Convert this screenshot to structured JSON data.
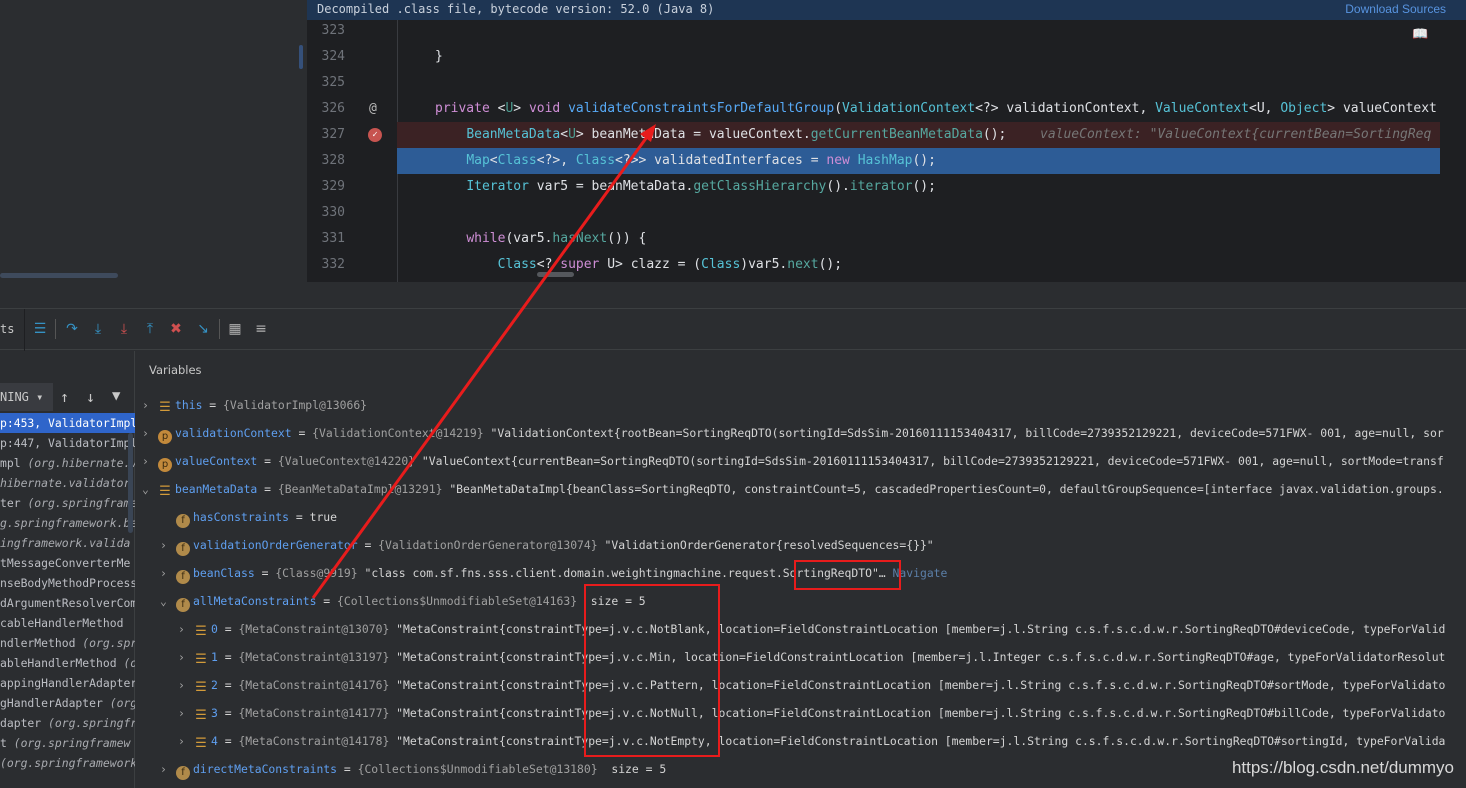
{
  "editor": {
    "banner": "Decompiled .class file, bytecode version: 52.0 (Java 8)",
    "download_sources": "Download Sources",
    "lines": [
      {
        "n": "323"
      },
      {
        "n": "324",
        "text": "}"
      },
      {
        "n": "325"
      },
      {
        "n": "326",
        "icon": "override-at-icon",
        "text": "private <U> void validateConstraintsForDefaultGroup(ValidationContext<?> validationContext, ValueContext<U, Object> valueContext"
      },
      {
        "n": "327",
        "icon": "breakpoint-icon",
        "text": "    BeanMetaData<U> beanMetaData = valueContext.getCurrentBeanMetaData();",
        "hint": "valueContext: \"ValueContext{currentBean=SortingReq"
      },
      {
        "n": "328",
        "text": "    Map<Class<?>, Class<?>> validatedInterfaces = new HashMap();"
      },
      {
        "n": "329",
        "text": "    Iterator var5 = beanMetaData.getClassHierarchy().iterator();"
      },
      {
        "n": "330"
      },
      {
        "n": "331",
        "text": "    while(var5.hasNext()) {"
      },
      {
        "n": "332",
        "text": "        Class<? super U> clazz = (Class)var5.next();"
      }
    ]
  },
  "toolbar": {
    "tab_partial": "ts",
    "buttons": [
      "show-execution-point",
      "step-over",
      "step-into",
      "force-step-into",
      "step-out",
      "drop-frame",
      "run-to-cursor",
      "evaluate-expression",
      "trace-current-stream"
    ]
  },
  "frames": {
    "thread_select": "NING",
    "items": [
      [
        "p:453, ValidatorImpl",
        ""
      ],
      [
        "p:447, ValidatorImpl",
        ""
      ],
      [
        "mpl ",
        "(org.hibernate.v"
      ],
      [
        "",
        "hibernate.validator"
      ],
      [
        "ter ",
        "(org.springframe"
      ],
      [
        "",
        "g.springframework.be"
      ],
      [
        "",
        "ingframework.valida"
      ],
      [
        "tMessageConverterMe",
        ""
      ],
      [
        "nseBodyMethodProcess",
        ""
      ],
      [
        "dArgumentResolverCom",
        ""
      ],
      [
        "cableHandlerMethod ",
        ""
      ],
      [
        "ndlerMethod ",
        "(org.spr"
      ],
      [
        "ableHandlerMethod ",
        "(o"
      ],
      [
        "appingHandlerAdapter",
        ""
      ],
      [
        "gHandlerAdapter ",
        "(org"
      ],
      [
        "dapter ",
        "(org.springfr"
      ],
      [
        "t ",
        "(org.springframew"
      ],
      [
        "",
        "(org.springframework"
      ]
    ]
  },
  "variables": {
    "header": "Variables",
    "rows": [
      {
        "chev": ">",
        "icon": "list",
        "name": "this",
        "type": "{ValidatorImpl@13066}",
        "value": ""
      },
      {
        "chev": ">",
        "icon": "p",
        "name": "validationContext",
        "type": "{ValidationContext@14219}",
        "value": "\"ValidationContext{rootBean=SortingReqDTO(sortingId=SdsSim-20160111153404317, billCode=2739352129221, deviceCode=571FWX- 001, age=null, sor"
      },
      {
        "chev": ">",
        "icon": "p",
        "name": "valueContext",
        "type": "{ValueContext@14220}",
        "value": "\"ValueContext{currentBean=SortingReqDTO(sortingId=SdsSim-20160111153404317, billCode=2739352129221, deviceCode=571FWX- 001, age=null, sortMode=transf"
      },
      {
        "chev": "v",
        "icon": "list",
        "name": "beanMetaData",
        "type": "{BeanMetaDataImpl@13291}",
        "value": "\"BeanMetaDataImpl{beanClass=SortingReqDTO, constraintCount=5, cascadedPropertiesCount=0, defaultGroupSequence=[interface javax.validation.groups."
      },
      {
        "chev": "",
        "icon": "f",
        "name": "hasConstraints",
        "type": "",
        "value": "true"
      },
      {
        "chev": ">",
        "icon": "f",
        "name": "validationOrderGenerator",
        "type": "{ValidationOrderGenerator@13074}",
        "value": "\"ValidationOrderGenerator{resolvedSequences={}}\""
      },
      {
        "chev": ">",
        "icon": "f",
        "name": "beanClass",
        "type": "{Class@9919}",
        "value": "\"class com.sf.fns.sss.client.domain.weightingmachine.request.SortingReqDTO\"…",
        "nav": "Navigate"
      },
      {
        "chev": "v",
        "icon": "f",
        "name": "allMetaConstraints",
        "type": "{Collections$UnmodifiableSet@14163}",
        "value": " size = 5"
      },
      {
        "chev": ">",
        "icon": "list",
        "name": "0",
        "type": "{MetaConstraint@13070}",
        "value": "\"MetaConstraint{constraintType=j.v.c.NotBlank, location=FieldConstraintLocation [member=j.l.String c.s.f.s.c.d.w.r.SortingReqDTO#deviceCode, typeForValid"
      },
      {
        "chev": ">",
        "icon": "list",
        "name": "1",
        "type": "{MetaConstraint@13197}",
        "value": "\"MetaConstraint{constraintType=j.v.c.Min, location=FieldConstraintLocation [member=j.l.Integer c.s.f.s.c.d.w.r.SortingReqDTO#age, typeForValidatorResolut"
      },
      {
        "chev": ">",
        "icon": "list",
        "name": "2",
        "type": "{MetaConstraint@14176}",
        "value": "\"MetaConstraint{constraintType=j.v.c.Pattern, location=FieldConstraintLocation [member=j.l.String c.s.f.s.c.d.w.r.SortingReqDTO#sortMode, typeForValidato"
      },
      {
        "chev": ">",
        "icon": "list",
        "name": "3",
        "type": "{MetaConstraint@14177}",
        "value": "\"MetaConstraint{constraintType=j.v.c.NotNull, location=FieldConstraintLocation [member=j.l.String c.s.f.s.c.d.w.r.SortingReqDTO#billCode, typeForValidato"
      },
      {
        "chev": ">",
        "icon": "list",
        "name": "4",
        "type": "{MetaConstraint@14178}",
        "value": "\"MetaConstraint{constraintType=j.v.c.NotEmpty, location=FieldConstraintLocation [member=j.l.String c.s.f.s.c.d.w.r.SortingReqDTO#sortingId, typeForValida"
      },
      {
        "chev": ">",
        "icon": "f",
        "name": "directMetaConstraints",
        "type": "{Collections$UnmodifiableSet@13180}",
        "value": " size = 5"
      }
    ]
  },
  "watermark": "https://blog.csdn.net/dummyo",
  "colors": {
    "annotation": "#e81c1c",
    "selection": "#2d5c96",
    "breakpoint_line": "#3b2224"
  }
}
